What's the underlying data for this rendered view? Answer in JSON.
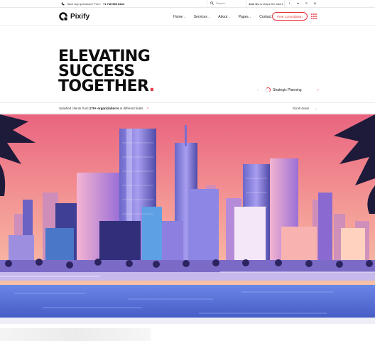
{
  "topbar": {
    "question": "Have any questions? Free:",
    "phone": "+1 738 583 8444",
    "search_placeholder": "Search...",
    "join_bold": "Join Us",
    "join_rest": "to shape the future",
    "social": [
      "f",
      "in",
      "𝕏",
      "◎"
    ]
  },
  "nav": {
    "brand": "Pixify",
    "menu": [
      {
        "label": "Home",
        "caret": "⌄"
      },
      {
        "label": "Services",
        "caret": "⌄"
      },
      {
        "label": "About",
        "caret": "⌄"
      },
      {
        "label": "Pages",
        "caret": "⌄"
      },
      {
        "label": "Contact",
        "caret": ""
      }
    ],
    "cta": "Free Consultation"
  },
  "hero": {
    "title_lines": [
      "ELEVATING",
      "SUCCESS",
      "TOGETHER"
    ],
    "title_dot": ".",
    "slide_label": "Strategic Planning",
    "prev": "‹",
    "next": "›"
  },
  "info": {
    "clients_pre": "Satisfied clients from",
    "clients_count": "170+",
    "clients_mid": "organization's",
    "clients_post": "in different fields",
    "arrow": "↗",
    "scroll": "Scroll down",
    "scroll_chevron": "⌄"
  },
  "colors": {
    "accent": "#e8333f",
    "sky_top": "#f07a8c",
    "sky_bottom": "#f9c9a8",
    "pool": "#5b73d8"
  }
}
